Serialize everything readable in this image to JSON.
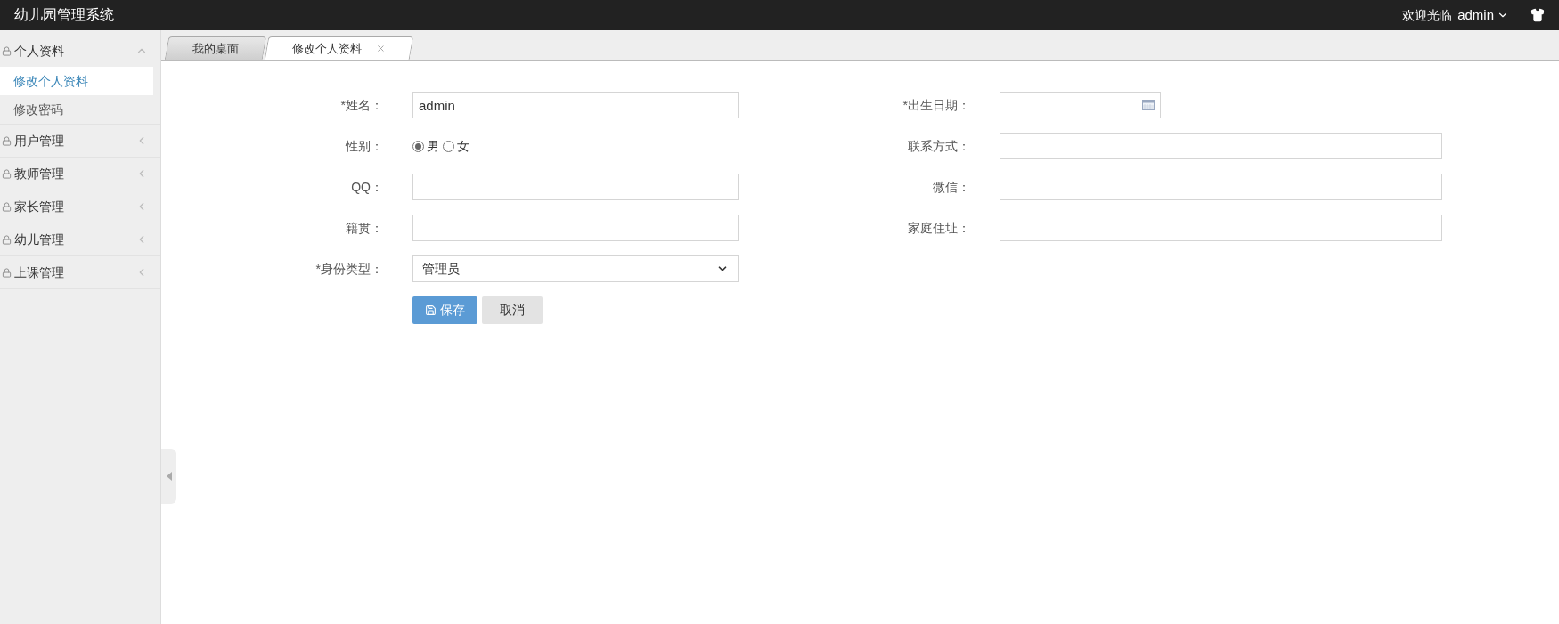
{
  "header": {
    "title": "幼儿园管理系统",
    "welcome": "欢迎光临",
    "user": "admin"
  },
  "sidebar": {
    "items": [
      {
        "label": "个人资料",
        "expanded": true,
        "children": [
          {
            "label": "修改个人资料",
            "selected": true
          },
          {
            "label": "修改密码",
            "selected": false
          }
        ]
      },
      {
        "label": "用户管理",
        "expanded": false
      },
      {
        "label": "教师管理",
        "expanded": false
      },
      {
        "label": "家长管理",
        "expanded": false
      },
      {
        "label": "幼儿管理",
        "expanded": false
      },
      {
        "label": "上课管理",
        "expanded": false
      }
    ]
  },
  "tabs": [
    {
      "label": "我的桌面",
      "selected": false,
      "closable": false
    },
    {
      "label": "修改个人资料",
      "selected": true,
      "closable": true
    }
  ],
  "form": {
    "left_fields": [
      {
        "kind": "text",
        "label": "*姓名：",
        "value": "admin"
      },
      {
        "kind": "radio",
        "label": "性别：",
        "options": [
          {
            "label": "男",
            "selected": true
          },
          {
            "label": "女",
            "selected": false
          }
        ]
      },
      {
        "kind": "text",
        "label": "QQ："
      },
      {
        "kind": "text",
        "label": "籍贯："
      },
      {
        "kind": "select",
        "label": "*身份类型：",
        "value": "管理员"
      }
    ],
    "right_fields": [
      {
        "kind": "date",
        "label": "*出生日期："
      },
      {
        "kind": "text",
        "label": "联系方式："
      },
      {
        "kind": "text",
        "label": "微信："
      },
      {
        "kind": "text",
        "label": "家庭住址："
      }
    ],
    "buttons": [
      {
        "kind": "primary",
        "label": "保存"
      },
      {
        "kind": "default",
        "label": "取消"
      }
    ]
  }
}
